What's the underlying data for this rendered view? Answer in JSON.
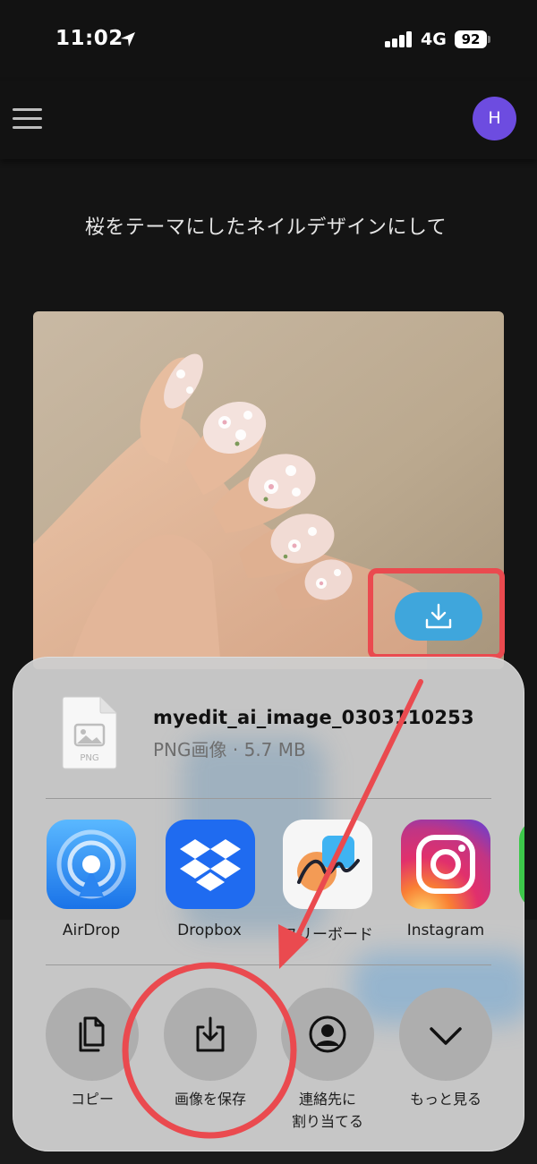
{
  "status_bar": {
    "time": "11:02",
    "network": "4G",
    "battery": "92"
  },
  "header": {
    "avatar_initial": "H"
  },
  "prompt_text": "桜をテーマにしたネイルデザインにして",
  "share_sheet": {
    "file_name": "myedit_ai_image_0303110253",
    "file_meta": "PNG画像 · 5.7 MB",
    "file_icon_label": "PNG",
    "apps": [
      {
        "label": "AirDrop",
        "icon": "airdrop-icon"
      },
      {
        "label": "Dropbox",
        "icon": "dropbox-icon"
      },
      {
        "label": "フリーボード",
        "icon": "freeform-icon"
      },
      {
        "label": "Instagram",
        "icon": "instagram-icon"
      }
    ],
    "actions": [
      {
        "label": "コピー",
        "icon": "copy-icon"
      },
      {
        "label": "画像を保存",
        "icon": "save-image-icon"
      },
      {
        "label": "連絡先に割り当てる",
        "line1": "連絡先に",
        "line2": "割り当てる",
        "icon": "contact-icon"
      },
      {
        "label": "もっと見る",
        "icon": "chevron-down-icon"
      }
    ]
  },
  "colors": {
    "annotation": "#ea4a4f",
    "download_button": "#3fa6dc",
    "avatar": "#6d4ce0"
  }
}
